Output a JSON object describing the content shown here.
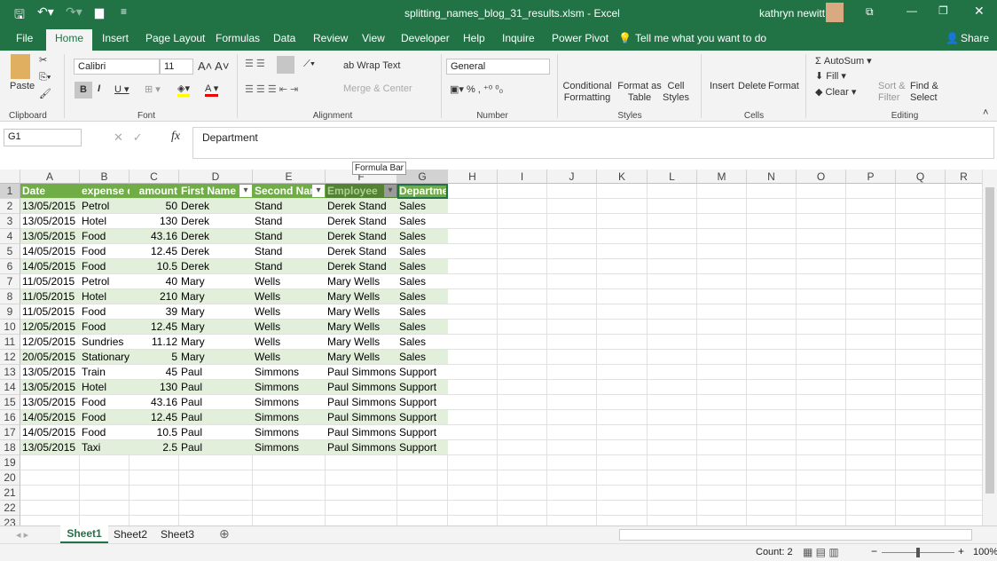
{
  "window": {
    "title": "splitting_names_blog_31_results.xlsm  -  Excel",
    "user": "kathryn newitt",
    "share": "Share"
  },
  "ribbon_tabs": [
    "File",
    "Home",
    "Insert",
    "Page Layout",
    "Formulas",
    "Data",
    "Review",
    "View",
    "Developer",
    "Help",
    "Inquire",
    "Power Pivot"
  ],
  "tell_me": "Tell me what you want to do",
  "clipboard": {
    "paste": "Paste",
    "label": "Clipboard"
  },
  "font": {
    "name": "Calibri",
    "size": "11",
    "label": "Font"
  },
  "alignment": {
    "wrap": "Wrap Text",
    "merge": "Merge & Center",
    "label": "Alignment"
  },
  "number": {
    "format": "General",
    "label": "Number"
  },
  "styles": {
    "conditional": "Conditional Formatting",
    "format_table": "Format as Table",
    "cell_styles": "Cell Styles",
    "label": "Styles"
  },
  "cells": {
    "insert": "Insert",
    "delete": "Delete",
    "format": "Format",
    "label": "Cells"
  },
  "editing": {
    "autosum": "AutoSum",
    "fill": "Fill",
    "clear": "Clear",
    "sort": "Sort & Filter",
    "find": "Find & Select",
    "label": "Editing"
  },
  "formula_bar": {
    "name_box": "G1",
    "fx": "fx",
    "value": "Department",
    "tooltip": "Formula Bar"
  },
  "columns": [
    "A",
    "B",
    "C",
    "D",
    "E",
    "F",
    "G",
    "H",
    "I",
    "J",
    "K",
    "L",
    "M",
    "N",
    "O",
    "P",
    "Q",
    "R"
  ],
  "headers": [
    "Date",
    "expense c",
    "amount",
    "First Name",
    "Second Nam",
    "Employee",
    "Departme"
  ],
  "rows": [
    [
      "13/05/2015",
      "Petrol",
      "50",
      "Derek",
      "Stand",
      "Derek Stand",
      "Sales"
    ],
    [
      "13/05/2015",
      "Hotel",
      "130",
      "Derek",
      "Stand",
      "Derek Stand",
      "Sales"
    ],
    [
      "13/05/2015",
      "Food",
      "43.16",
      "Derek",
      "Stand",
      "Derek Stand",
      "Sales"
    ],
    [
      "14/05/2015",
      "Food",
      "12.45",
      "Derek",
      "Stand",
      "Derek Stand",
      "Sales"
    ],
    [
      "14/05/2015",
      "Food",
      "10.5",
      "Derek",
      "Stand",
      "Derek Stand",
      "Sales"
    ],
    [
      "11/05/2015",
      "Petrol",
      "40",
      "Mary",
      "Wells",
      "Mary Wells",
      "Sales"
    ],
    [
      "11/05/2015",
      "Hotel",
      "210",
      "Mary",
      "Wells",
      "Mary Wells",
      "Sales"
    ],
    [
      "11/05/2015",
      "Food",
      "39",
      "Mary",
      "Wells",
      "Mary Wells",
      "Sales"
    ],
    [
      "12/05/2015",
      "Food",
      "12.45",
      "Mary",
      "Wells",
      "Mary Wells",
      "Sales"
    ],
    [
      "12/05/2015",
      "Sundries",
      "11.12",
      "Mary",
      "Wells",
      "Mary Wells",
      "Sales"
    ],
    [
      "20/05/2015",
      "Stationary",
      "5",
      "Mary",
      "Wells",
      "Mary Wells",
      "Sales"
    ],
    [
      "13/05/2015",
      "Train",
      "45",
      "Paul",
      "Simmons",
      "Paul Simmons",
      "Support"
    ],
    [
      "13/05/2015",
      "Hotel",
      "130",
      "Paul",
      "Simmons",
      "Paul Simmons",
      "Support"
    ],
    [
      "13/05/2015",
      "Food",
      "43.16",
      "Paul",
      "Simmons",
      "Paul Simmons",
      "Support"
    ],
    [
      "14/05/2015",
      "Food",
      "12.45",
      "Paul",
      "Simmons",
      "Paul Simmons",
      "Support"
    ],
    [
      "14/05/2015",
      "Food",
      "10.5",
      "Paul",
      "Simmons",
      "Paul Simmons",
      "Support"
    ],
    [
      "13/05/2015",
      "Taxi",
      "2.5",
      "Paul",
      "Simmons",
      "Paul Simmons",
      "Support"
    ]
  ],
  "row_numbers": [
    "1",
    "2",
    "3",
    "4",
    "5",
    "6",
    "7",
    "8",
    "9",
    "10",
    "11",
    "12",
    "13",
    "14",
    "15",
    "16",
    "17",
    "18",
    "19",
    "20",
    "21",
    "22",
    "23"
  ],
  "sheets": [
    "Sheet1",
    "Sheet2",
    "Sheet3"
  ],
  "status": {
    "count": "Count: 2",
    "zoom": "100%"
  },
  "colors": {
    "excel_green": "#217346",
    "table_header": "#70ad47",
    "band": "#e2efda"
  }
}
